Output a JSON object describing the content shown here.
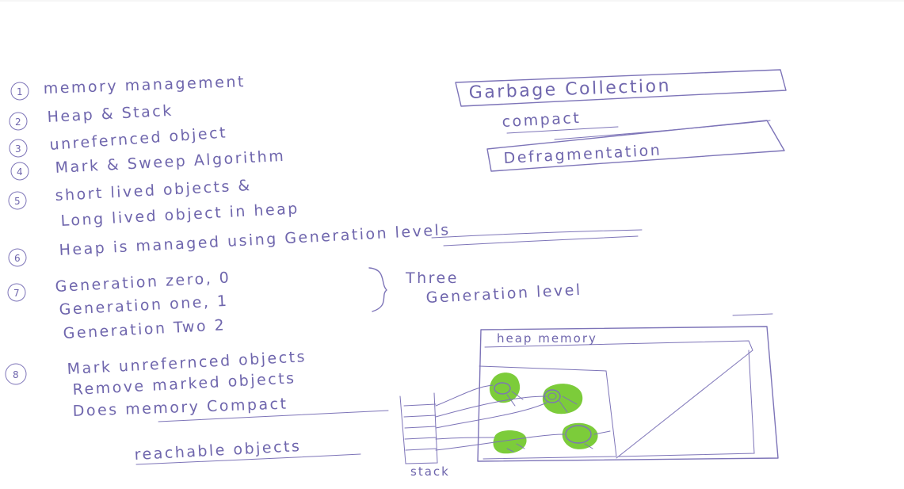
{
  "notes": {
    "items": [
      {
        "number": "1",
        "lines": [
          "memory management"
        ]
      },
      {
        "number": "2",
        "lines": [
          "Heap & Stack"
        ]
      },
      {
        "number": "3",
        "lines": [
          "unrefernced object"
        ]
      },
      {
        "number": "4",
        "lines": [
          "Mark & Sweep Algorithm"
        ]
      },
      {
        "number": "5",
        "lines": [
          "short lived objects &",
          "Long lived object in heap"
        ]
      },
      {
        "number": "6",
        "lines": [
          "Heap is managed using Generation levels"
        ]
      },
      {
        "number": "7",
        "lines": [
          "Generation zero, 0",
          "Generation one, 1",
          "Generation Two 2"
        ]
      },
      {
        "number": "8",
        "lines": [
          "Mark unrefernced objects",
          "Remove marked objects",
          "Does memory Compact"
        ]
      }
    ],
    "generation_brace_label": [
      "Three",
      "Generation level"
    ],
    "reachable_label": "reachable objects"
  },
  "keywords": {
    "garbage_collection": "Garbage Collection",
    "compact": "compact",
    "defragmentation": "Defragmentation"
  },
  "diagram": {
    "heap_label": "heap memory",
    "stack_label": "stack"
  },
  "colors": {
    "ink": "#7d74b8",
    "object_fill": "#7ccc3a",
    "background": "#ffffff"
  }
}
